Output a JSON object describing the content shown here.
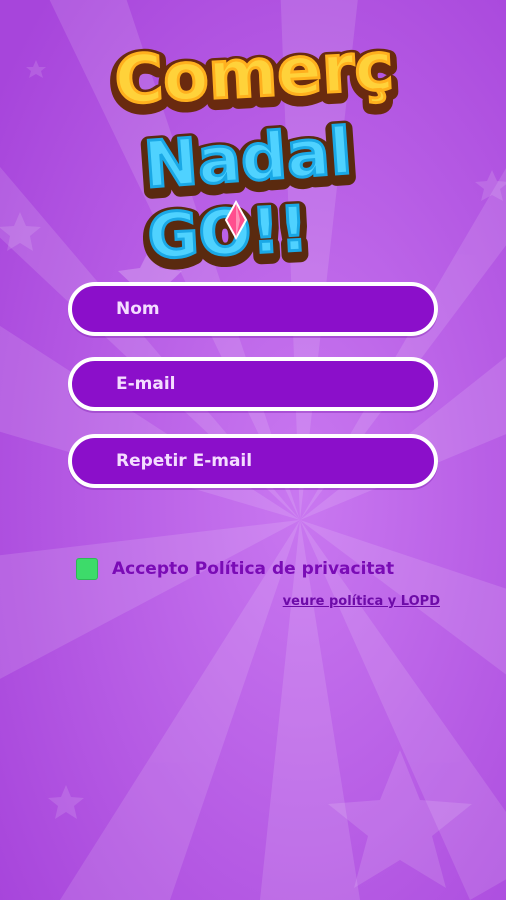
{
  "logo": {
    "line1": "Comerç",
    "line2": "Nadal",
    "line3": "GO!!"
  },
  "form": {
    "name_placeholder": "Nom",
    "email_placeholder": "E-mail",
    "repeat_email_placeholder": "Repetir E-mail",
    "accept_label": "Accepto Política de privacitat",
    "accept_checked": true,
    "policy_link": "veure política y LOPD"
  },
  "colors": {
    "background": "#b04fe0",
    "field_fill": "#8b0fca",
    "field_border": "#ffffff",
    "checkbox": "#3ddb6a",
    "label_text": "#7a0bb6"
  }
}
